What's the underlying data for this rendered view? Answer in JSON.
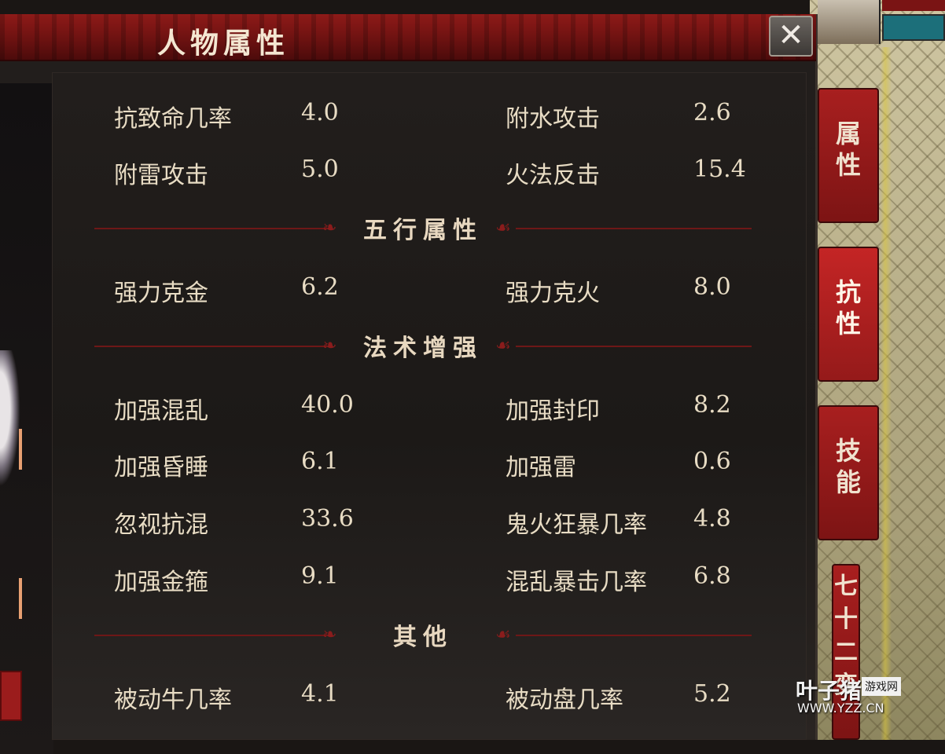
{
  "window": {
    "title": "人物属性",
    "close_label": "✕"
  },
  "stats_top": [
    {
      "label": "抗致命几率",
      "value": "4.0",
      "label2": "附水攻击",
      "value2": "2.6"
    },
    {
      "label": "附雷攻击",
      "value": "5.0",
      "label2": "火法反击",
      "value2": "15.4"
    }
  ],
  "sections": {
    "wuxing": "五行属性",
    "fashu": "法术增强",
    "qita": "其他"
  },
  "stats_wuxing": [
    {
      "label": "强力克金",
      "value": "6.2",
      "label2": "强力克火",
      "value2": "8.0"
    }
  ],
  "stats_fashu": [
    {
      "label": "加强混乱",
      "value": "40.0",
      "label2": "加强封印",
      "value2": "8.2"
    },
    {
      "label": "加强昏睡",
      "value": "6.1",
      "label2": "加强雷",
      "value2": "0.6"
    },
    {
      "label": "忽视抗混",
      "value": "33.6",
      "label2": "鬼火狂暴几率",
      "value2": "4.8"
    },
    {
      "label": "加强金箍",
      "value": "9.1",
      "label2": "混乱暴击几率",
      "value2": "6.8"
    }
  ],
  "stats_qita": [
    {
      "label": "被动牛几率",
      "value": "4.1",
      "label2": "被动盘几率",
      "value2": "5.2"
    }
  ],
  "tabs": [
    {
      "line1": "属",
      "line2": "性"
    },
    {
      "line1": "抗",
      "line2": "性"
    },
    {
      "line1": "技",
      "line2": "能"
    },
    {
      "line1": "七十二变",
      "line2": ""
    }
  ],
  "watermark": {
    "main": "叶子猪",
    "tag": "游戏网",
    "url": "WWW.YZZ.CN"
  },
  "colors": {
    "accent": "#a81f1f",
    "text": "#e8dcc4",
    "title_bar": "#7a1414"
  }
}
